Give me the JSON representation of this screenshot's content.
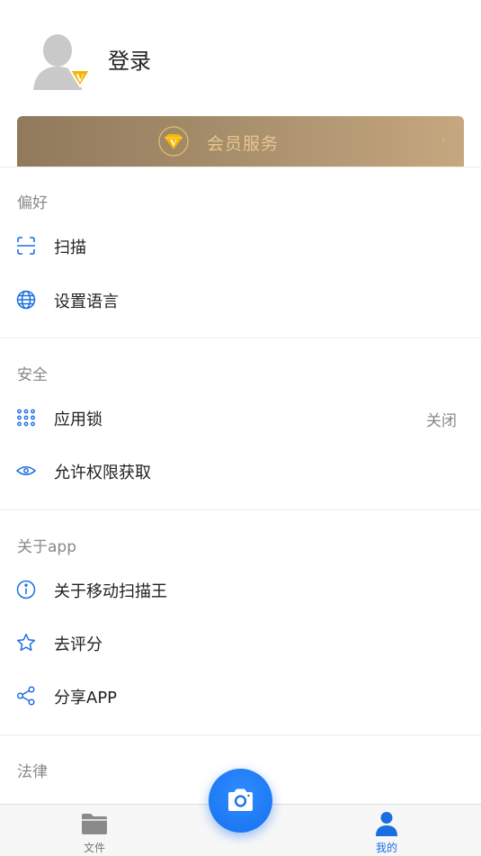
{
  "profile": {
    "login_label": "登录"
  },
  "vip": {
    "label": "会员服务",
    "chevron": "›"
  },
  "sections": {
    "preferences": {
      "title": "偏好",
      "items": [
        {
          "label": "扫描",
          "icon": "scan-icon"
        },
        {
          "label": "设置语言",
          "icon": "globe-icon"
        }
      ]
    },
    "security": {
      "title": "安全",
      "items": [
        {
          "label": "应用锁",
          "icon": "keypad-icon",
          "value": "关闭"
        },
        {
          "label": "允许权限获取",
          "icon": "eye-icon"
        }
      ]
    },
    "about": {
      "title": "关于app",
      "items": [
        {
          "label": "关于移动扫描王",
          "icon": "info-icon"
        },
        {
          "label": "去评分",
          "icon": "star-icon"
        },
        {
          "label": "分享APP",
          "icon": "share-icon"
        }
      ]
    },
    "legal": {
      "title": "法律"
    }
  },
  "bottom_nav": {
    "files": {
      "label": "文件",
      "icon": "folder-icon"
    },
    "camera": {
      "icon": "camera-icon"
    },
    "mine": {
      "label": "我的",
      "icon": "person-icon",
      "active": true
    }
  },
  "colors": {
    "accent": "#1a6fe0",
    "vip_gold": "#e6c68c",
    "section_title": "#888888"
  }
}
